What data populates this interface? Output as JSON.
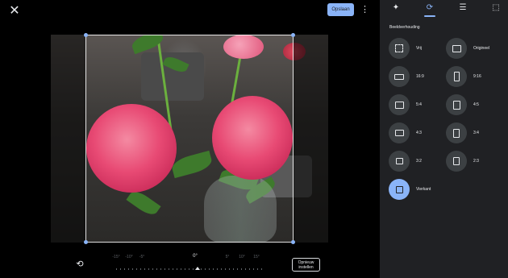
{
  "toolbar": {
    "save_label": "Opslaan"
  },
  "rotation_dial": {
    "angles": [
      "-15°",
      "-10°",
      "-5°",
      "0°",
      "5°",
      "10°",
      "15°"
    ],
    "current_label": "0°",
    "value_degrees": 0
  },
  "reset_button": {
    "line1": "Opnieuw",
    "line2": "instellen"
  },
  "panel": {
    "tabs": [
      {
        "icon": "auto-enhance-icon",
        "active": false
      },
      {
        "icon": "crop-rotate-icon",
        "active": true
      },
      {
        "icon": "adjust-sliders-icon",
        "active": false
      },
      {
        "icon": "markup-icon",
        "active": false
      }
    ],
    "section_title": "Beeldverhouding",
    "ratios": [
      {
        "label": "Vrij",
        "icon": "free-crop-icon"
      },
      {
        "label": "Origineel",
        "icon": "original-ratio-icon"
      },
      {
        "label": "16:9",
        "icon": "landscape-ratio-icon"
      },
      {
        "label": "9:16",
        "icon": "portrait-ratio-icon"
      },
      {
        "label": "5:4",
        "icon": "landscape-ratio-icon"
      },
      {
        "label": "4:5",
        "icon": "portrait-ratio-icon"
      },
      {
        "label": "4:3",
        "icon": "landscape-ratio-icon"
      },
      {
        "label": "3:4",
        "icon": "portrait-ratio-icon"
      },
      {
        "label": "3:2",
        "icon": "landscape-ratio-icon"
      },
      {
        "label": "2:3",
        "icon": "portrait-ratio-icon"
      },
      {
        "label": "Vierkant",
        "icon": "square-ratio-icon",
        "selected": true
      }
    ]
  },
  "colors": {
    "accent": "#8ab4f8",
    "panel_bg": "#202124",
    "canvas_bg": "#000000",
    "chip_bg": "#3c4043"
  }
}
